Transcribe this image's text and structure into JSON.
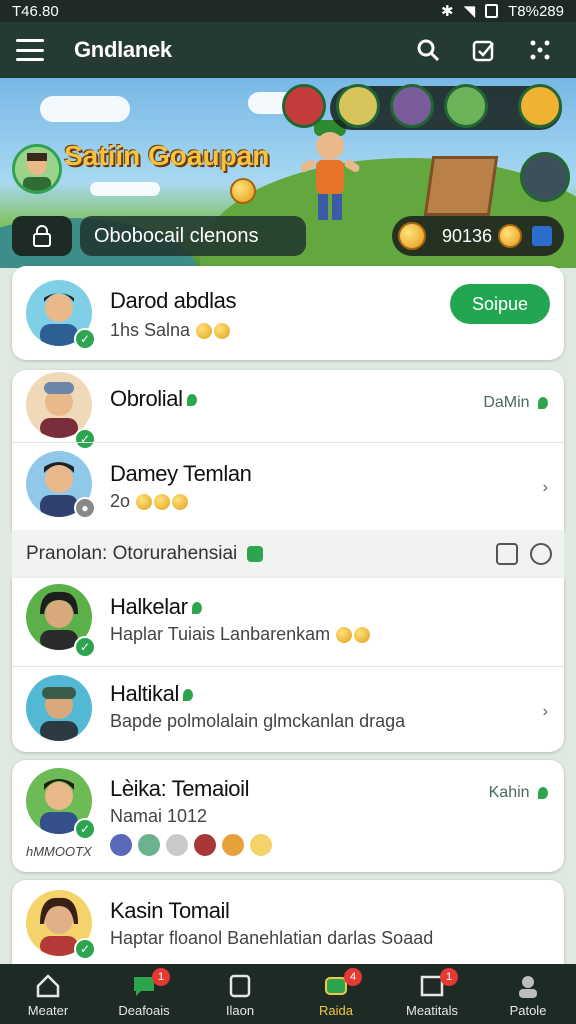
{
  "status_bar": {
    "time": "T46.80",
    "right_text": "T8%289"
  },
  "app": {
    "title": "Gndlanek"
  },
  "hero": {
    "profile_name": "Satiin Goaupan",
    "status_text": "Obobocail clenons",
    "coins_text": "90136"
  },
  "featured": {
    "name": "Darod abdlas",
    "subtitle": "1hs  Salna",
    "button_label": "Soipue"
  },
  "group1": [
    {
      "name": "Obrolial",
      "subtitle": "",
      "meta": "DaMin"
    },
    {
      "name": "Damey Temlan",
      "subtitle": "2o",
      "meta": ""
    }
  ],
  "section": {
    "label": "Pranolan: Otorurahensiai"
  },
  "group2": [
    {
      "name": "Halkelar",
      "subtitle": "Haplar Tuiais  Lanbarenkam"
    },
    {
      "name": "Haltikal",
      "subtitle": "Bapde polmolalain glmckanlan draga"
    }
  ],
  "group3": [
    {
      "name": "Lèika: Temaioil",
      "subtitle": "Namai 1012",
      "meta": "Kahin",
      "caption": "hMMOOTX"
    }
  ],
  "group4": [
    {
      "name": "Kasin Tomail",
      "subtitle": "Haptar floanol Banehlatian darlas Soaad"
    }
  ],
  "bottom_nav": [
    {
      "label": "Meater",
      "badge": ""
    },
    {
      "label": "Deafoais",
      "badge": "1"
    },
    {
      "label": "Ilaon",
      "badge": ""
    },
    {
      "label": "Raida",
      "badge": "4"
    },
    {
      "label": "Meatitals",
      "badge": "1"
    },
    {
      "label": "Patole",
      "badge": ""
    }
  ],
  "colors": {
    "accent": "#22a652",
    "appbar": "#253a30",
    "nav_active": "#f2c744"
  }
}
